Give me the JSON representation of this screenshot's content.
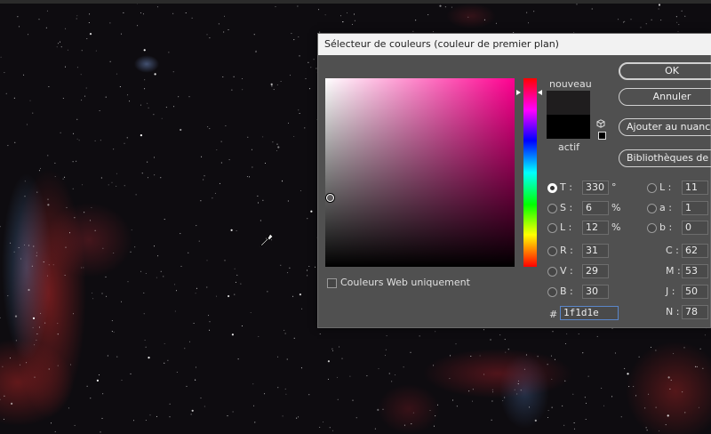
{
  "dialog": {
    "title": "Sélecteur de couleurs (couleur de premier plan)",
    "new_label": "nouveau",
    "current_label": "actif",
    "new_color": "#1f1d1e",
    "current_color": "#000000",
    "buttons": {
      "ok": "OK",
      "cancel": "Annuler",
      "add_swatch": "Ajouter au nuancier",
      "libraries": "Bibliothèques de couleurs"
    },
    "web_only_label": "Couleurs Web uniquement",
    "hsl": {
      "t_label": "T :",
      "t_value": "330",
      "t_unit": "°",
      "s_label": "S :",
      "s_value": "6",
      "s_unit": "%",
      "l_label": "L :",
      "l_value": "12",
      "l_unit": "%"
    },
    "rgb": {
      "r_label": "R :",
      "r_value": "31",
      "v_label": "V :",
      "v_value": "29",
      "b_label": "B :",
      "b_value": "30"
    },
    "lab": {
      "l_label": "L :",
      "l_value": "11",
      "a_label": "a :",
      "a_value": "1",
      "b_label": "b :",
      "b_value": "0"
    },
    "cmyk": {
      "c_label": "C :",
      "c_value": "62",
      "m_label": "M :",
      "m_value": "53",
      "j_label": "J :",
      "j_value": "50",
      "n_label": "N :",
      "n_value": "78"
    },
    "hex_label": "#",
    "hex_value": "1f1d1e",
    "selected_mode": "T"
  }
}
